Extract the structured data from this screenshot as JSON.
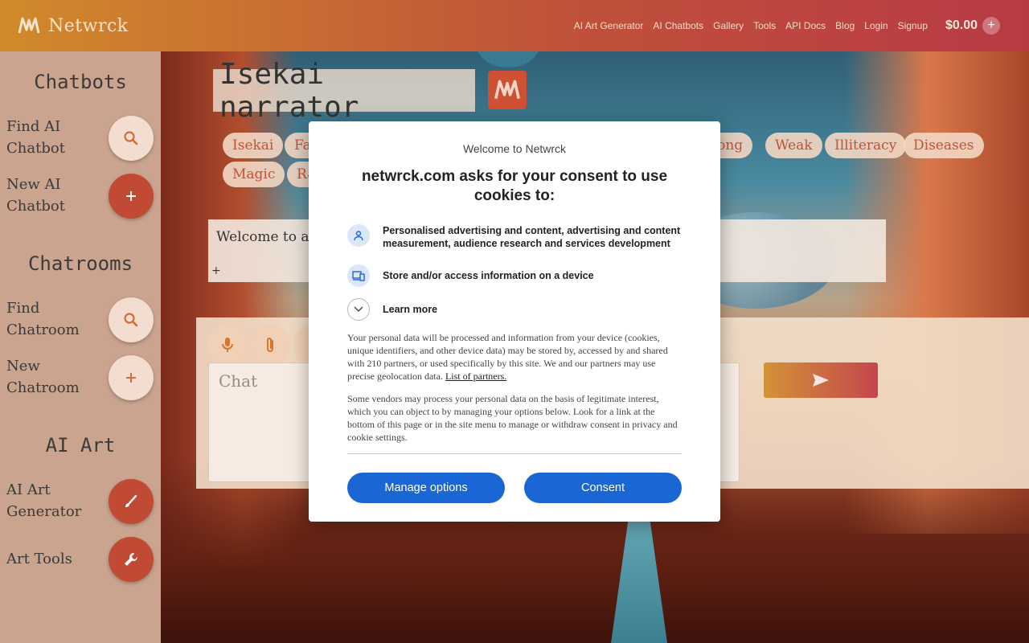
{
  "header": {
    "brand": "Netwrck",
    "nav": [
      "AI Art Generator",
      "AI Chatbots",
      "Gallery",
      "Tools",
      "API Docs",
      "Blog",
      "Login",
      "Signup"
    ],
    "balance": "$0.00",
    "add_funds": "+"
  },
  "sidebar": {
    "chatbots_heading": "Chatbots",
    "find_chatbot": "Find AI Chatbot",
    "new_chatbot": "New AI Chatbot",
    "chatrooms_heading": "Chatrooms",
    "find_chatroom": "Find Chatroom",
    "new_chatroom": "New Chatroom",
    "ai_art_heading": "AI Art",
    "art_generator": "AI Art Generator",
    "art_tools": "Art Tools"
  },
  "main": {
    "title": "Isekai narrator",
    "tags_row1": [
      "Isekai",
      "Fa",
      "rong",
      "Weak",
      "Illiteracy",
      "Diseases"
    ],
    "tags_row2": [
      "Magic",
      "Ra"
    ],
    "description": "Welcome to a w",
    "description_add": "+",
    "chat_placeholder": "Chat"
  },
  "modal": {
    "welcome": "Welcome to Netwrck",
    "heading": "netwrck.com asks for your consent to use cookies to:",
    "purpose1": "Personalised advertising and content, advertising and content measurement, audience research and services development",
    "purpose2": "Store and/or access information on a device",
    "learn_more": "Learn more",
    "para1": "Your personal data will be processed and information from your device (cookies, unique identifiers, and other device data) may be stored by, accessed by and shared with 210 partners, or used specifically by this site. We and our partners may use precise geolocation data.",
    "partners_link": "List of partners.",
    "para2": "Some vendors may process your personal data on the basis of legitimate interest, which you can object to by managing your options below. Look for a link at the bottom of this page or in the site menu to manage or withdraw consent in privacy and cookie settings.",
    "manage_button": "Manage options",
    "consent_button": "Consent"
  },
  "colors": {
    "accent_blue": "#1a66d4",
    "brand_red": "#c04a33",
    "brand_orange": "#d08a2a"
  }
}
